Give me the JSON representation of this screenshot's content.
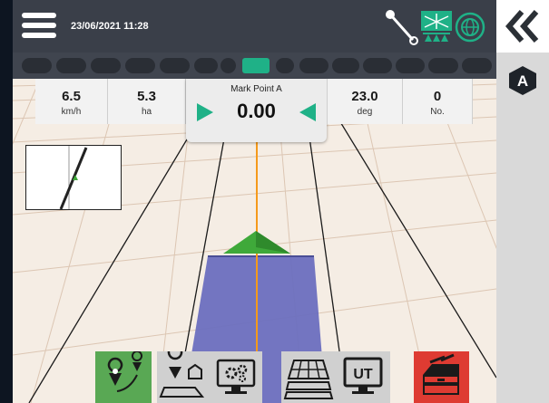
{
  "header": {
    "datetime": "23/06/2021 11:28",
    "icons": [
      "menu-icon",
      "implement-hitch-icon",
      "section-control-icon",
      "gnss-globe-icon"
    ]
  },
  "section_bar": {
    "sections": 15,
    "active_index": 7,
    "active_color": "#1fb187"
  },
  "info": {
    "speed": {
      "value": "6.5",
      "unit": "km/h"
    },
    "area": {
      "value": "5.3",
      "unit": "ha"
    },
    "mark_point": {
      "title": "Mark Point A",
      "value": "0.00"
    },
    "heading": {
      "value": "23.0",
      "unit": "deg"
    },
    "count": {
      "value": "0",
      "unit": "No."
    }
  },
  "right_panel": {
    "collapse_icon": "double-chevron-left-icon",
    "mode_badge": "A"
  },
  "toolbar": {
    "buttons": [
      {
        "name": "guidance",
        "icon": "route-points-icon",
        "color": "#59a854"
      },
      {
        "name": "field-map",
        "icon": "field-location-icon"
      },
      {
        "name": "settings",
        "icon": "monitor-gears-icon"
      },
      {
        "name": "layers",
        "icon": "field-layers-icon"
      },
      {
        "name": "universal-terminal",
        "icon": "ut-monitor-icon",
        "label": "UT"
      },
      {
        "name": "toolbox",
        "icon": "toolbox-icon",
        "color": "#de3b32"
      }
    ]
  },
  "colors": {
    "topbar": "#3a3f49",
    "field": "#f5ede4",
    "coverage": "#6b6fbf",
    "guidance_line": "#f59a1b",
    "vehicle": "#3fa93a"
  }
}
